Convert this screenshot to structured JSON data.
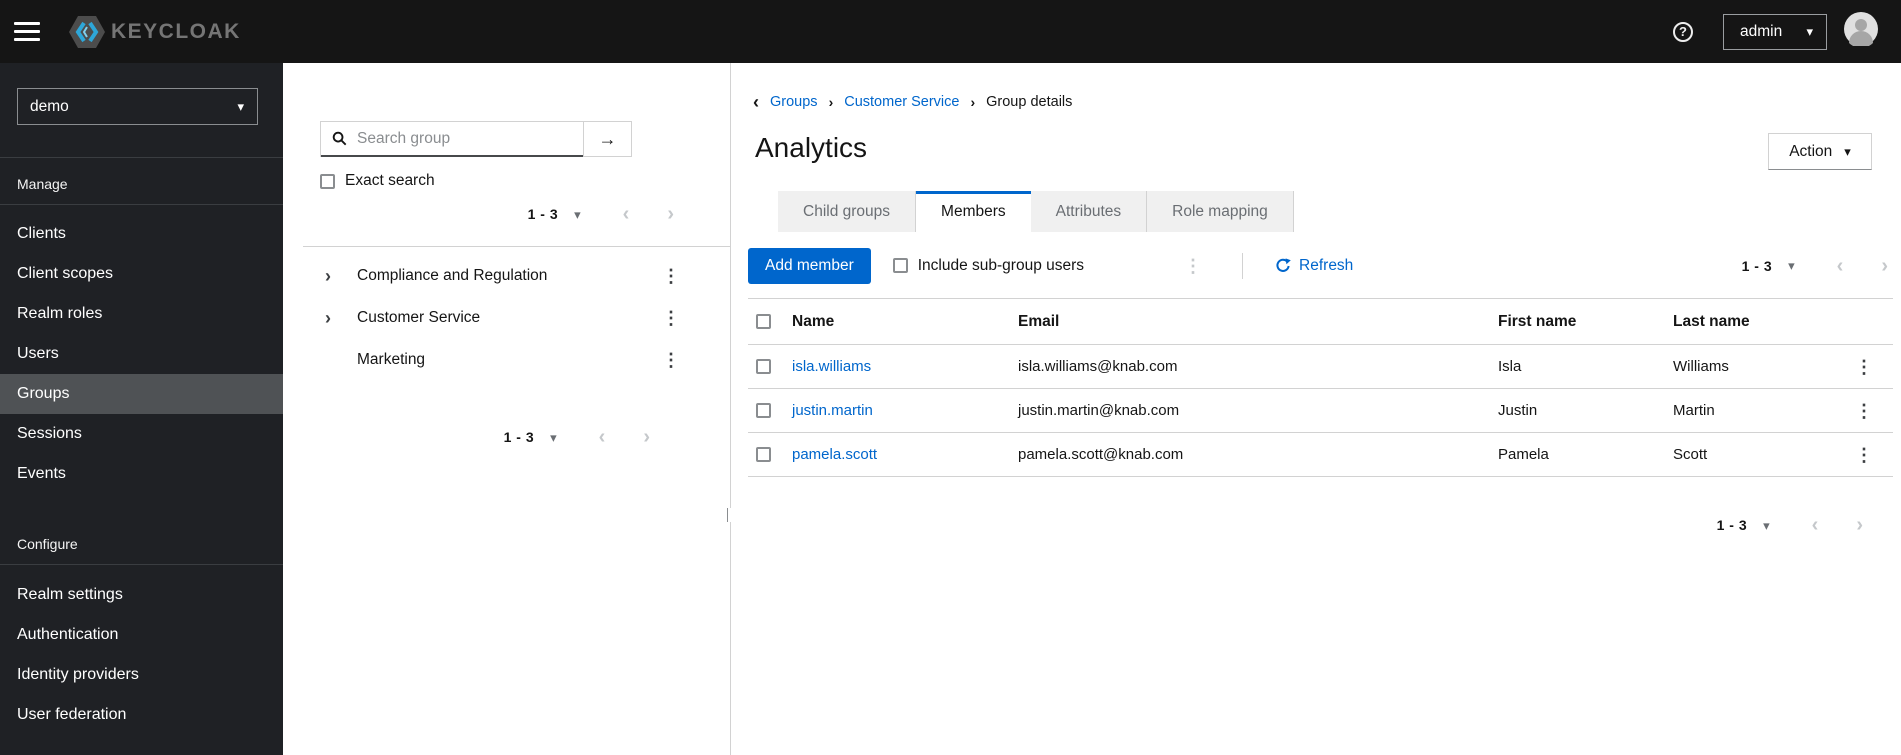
{
  "header": {
    "brand": "KEYCLOAK",
    "user": "admin"
  },
  "sidebar": {
    "realm": "demo",
    "sections": [
      {
        "label": "Manage",
        "items": [
          "Clients",
          "Client scopes",
          "Realm roles",
          "Users",
          "Groups",
          "Sessions",
          "Events"
        ],
        "active_item": "Groups"
      },
      {
        "label": "Configure",
        "items": [
          "Realm settings",
          "Authentication",
          "Identity providers",
          "User federation"
        ]
      }
    ]
  },
  "groups_panel": {
    "search_placeholder": "Search group",
    "exact_search_label": "Exact search",
    "pagination_top": {
      "range": "1 - 3"
    },
    "tree": [
      {
        "name": "Compliance and Regulation",
        "expandable": true
      },
      {
        "name": "Customer Service",
        "expandable": true
      },
      {
        "name": "Marketing",
        "expandable": false
      }
    ],
    "pagination_bottom": {
      "range": "1 - 3"
    }
  },
  "main": {
    "breadcrumb": {
      "items": [
        "Groups",
        "Customer Service",
        "Group details"
      ]
    },
    "title": "Analytics",
    "action_label": "Action",
    "tabs": [
      {
        "label": "Child groups",
        "active": false
      },
      {
        "label": "Members",
        "active": true
      },
      {
        "label": "Attributes",
        "active": false
      },
      {
        "label": "Role mapping",
        "active": false
      }
    ],
    "toolbar": {
      "add_member": "Add member",
      "include_subgroups": "Include sub-group users",
      "refresh": "Refresh",
      "pagination": {
        "range": "1 - 3"
      }
    },
    "table": {
      "columns": [
        "Name",
        "Email",
        "First name",
        "Last name"
      ],
      "rows": [
        {
          "username": "isla.williams",
          "email": "isla.williams@knab.com",
          "first_name": "Isla",
          "last_name": "Williams"
        },
        {
          "username": "justin.martin",
          "email": "justin.martin@knab.com",
          "first_name": "Justin",
          "last_name": "Martin"
        },
        {
          "username": "pamela.scott",
          "email": "pamela.scott@knab.com",
          "first_name": "Pamela",
          "last_name": "Scott"
        }
      ]
    },
    "pagination_bottom": {
      "range": "1 - 3"
    }
  },
  "glyphs": {
    "caret_down": "▾",
    "chevron_left": "‹",
    "chevron_right": "›",
    "kebab": "⋮",
    "arrow_right": "→",
    "question_mark": "?",
    "tree_expand": "›",
    "breadcrumb_sep": "›",
    "back": "‹"
  },
  "colors": {
    "primary": "#0066cc",
    "masthead": "#151515",
    "sidebar": "#1f2125",
    "sidebar_active": "#4f5255",
    "tab_inactive_bg": "#f0f0f0",
    "border": "#d2d2d2",
    "link": "#0066cc"
  }
}
